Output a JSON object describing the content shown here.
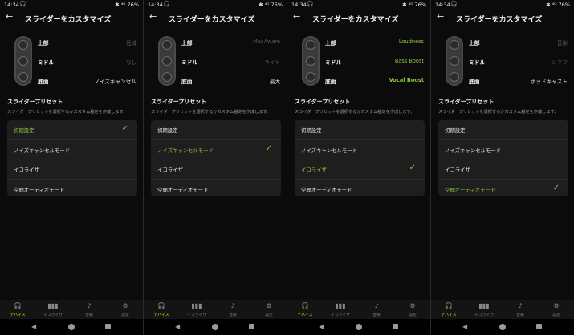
{
  "status_time": "14:34",
  "status_right": "✱ ⁴ᴳ 76%",
  "screen_title": "スライダーをカスタマイズ",
  "slider_labels": [
    "上部",
    "ミドル",
    "底面"
  ],
  "section_title": "スライダープリセット",
  "section_desc": "スライダープリセットを選択するかカスタム設定を作成します。",
  "preset_labels": [
    "初期設定",
    "ノイズキャンセルモード",
    "イコライザ",
    "空間オーディオモード"
  ],
  "nav_labels": [
    "デバイス",
    "イコライザ",
    "音楽",
    "設定"
  ],
  "accent_color": "#8dc63f",
  "active_nav_color": "#c7e000",
  "icons": {
    "back": "arrow-left-icon",
    "check": "checkmark-icon",
    "nav": [
      "headphones-icon",
      "equalizer-icon",
      "music-note-icon",
      "gear-icon"
    ],
    "system": [
      "back-triangle-icon",
      "home-circle-icon",
      "recent-square-icon"
    ]
  },
  "phones": [
    {
      "values": [
        "低域",
        "なし",
        "ノイズキャンセル"
      ],
      "value_styles": [
        "dim",
        "dim",
        "white"
      ],
      "selected_preset": 0
    },
    {
      "values": [
        "MaxAware",
        "ライト",
        "最大"
      ],
      "value_styles": [
        "dim",
        "dim",
        "white"
      ],
      "selected_preset": 1
    },
    {
      "values": [
        "Loudness",
        "Bass Boost",
        "Vocal Boost"
      ],
      "value_styles": [
        "green",
        "green",
        "green-bold"
      ],
      "selected_preset": 2
    },
    {
      "values": [
        "音楽",
        "シネマ",
        "ポッドキャスト"
      ],
      "value_styles": [
        "dim",
        "dim",
        "white"
      ],
      "selected_preset": 3
    }
  ]
}
